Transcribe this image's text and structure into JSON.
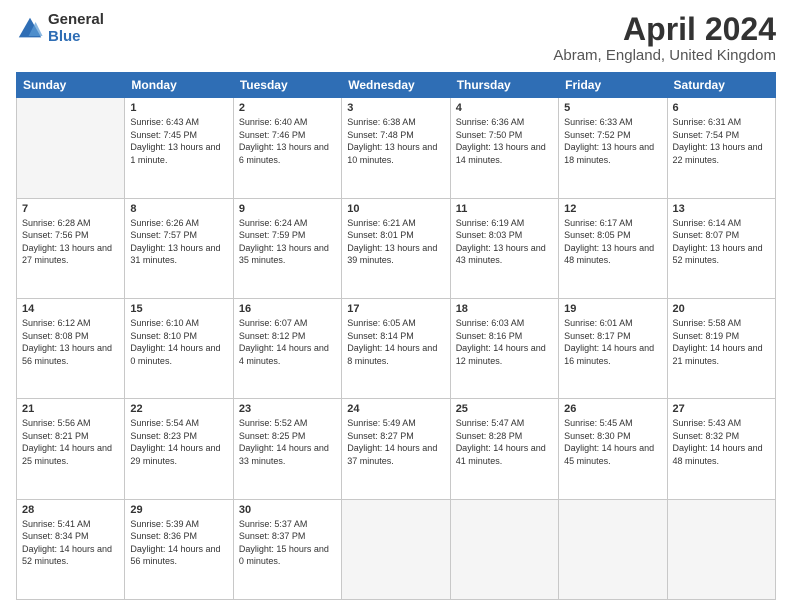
{
  "logo": {
    "general": "General",
    "blue": "Blue"
  },
  "title": "April 2024",
  "location": "Abram, England, United Kingdom",
  "weekdays": [
    "Sunday",
    "Monday",
    "Tuesday",
    "Wednesday",
    "Thursday",
    "Friday",
    "Saturday"
  ],
  "weeks": [
    [
      {
        "day": "",
        "sunrise": "",
        "sunset": "",
        "daylight": ""
      },
      {
        "day": "1",
        "sunrise": "6:43 AM",
        "sunset": "7:45 PM",
        "daylight": "13 hours and 1 minute."
      },
      {
        "day": "2",
        "sunrise": "6:40 AM",
        "sunset": "7:46 PM",
        "daylight": "13 hours and 6 minutes."
      },
      {
        "day": "3",
        "sunrise": "6:38 AM",
        "sunset": "7:48 PM",
        "daylight": "13 hours and 10 minutes."
      },
      {
        "day": "4",
        "sunrise": "6:36 AM",
        "sunset": "7:50 PM",
        "daylight": "13 hours and 14 minutes."
      },
      {
        "day": "5",
        "sunrise": "6:33 AM",
        "sunset": "7:52 PM",
        "daylight": "13 hours and 18 minutes."
      },
      {
        "day": "6",
        "sunrise": "6:31 AM",
        "sunset": "7:54 PM",
        "daylight": "13 hours and 22 minutes."
      }
    ],
    [
      {
        "day": "7",
        "sunrise": "6:28 AM",
        "sunset": "7:56 PM",
        "daylight": "13 hours and 27 minutes."
      },
      {
        "day": "8",
        "sunrise": "6:26 AM",
        "sunset": "7:57 PM",
        "daylight": "13 hours and 31 minutes."
      },
      {
        "day": "9",
        "sunrise": "6:24 AM",
        "sunset": "7:59 PM",
        "daylight": "13 hours and 35 minutes."
      },
      {
        "day": "10",
        "sunrise": "6:21 AM",
        "sunset": "8:01 PM",
        "daylight": "13 hours and 39 minutes."
      },
      {
        "day": "11",
        "sunrise": "6:19 AM",
        "sunset": "8:03 PM",
        "daylight": "13 hours and 43 minutes."
      },
      {
        "day": "12",
        "sunrise": "6:17 AM",
        "sunset": "8:05 PM",
        "daylight": "13 hours and 48 minutes."
      },
      {
        "day": "13",
        "sunrise": "6:14 AM",
        "sunset": "8:07 PM",
        "daylight": "13 hours and 52 minutes."
      }
    ],
    [
      {
        "day": "14",
        "sunrise": "6:12 AM",
        "sunset": "8:08 PM",
        "daylight": "13 hours and 56 minutes."
      },
      {
        "day": "15",
        "sunrise": "6:10 AM",
        "sunset": "8:10 PM",
        "daylight": "14 hours and 0 minutes."
      },
      {
        "day": "16",
        "sunrise": "6:07 AM",
        "sunset": "8:12 PM",
        "daylight": "14 hours and 4 minutes."
      },
      {
        "day": "17",
        "sunrise": "6:05 AM",
        "sunset": "8:14 PM",
        "daylight": "14 hours and 8 minutes."
      },
      {
        "day": "18",
        "sunrise": "6:03 AM",
        "sunset": "8:16 PM",
        "daylight": "14 hours and 12 minutes."
      },
      {
        "day": "19",
        "sunrise": "6:01 AM",
        "sunset": "8:17 PM",
        "daylight": "14 hours and 16 minutes."
      },
      {
        "day": "20",
        "sunrise": "5:58 AM",
        "sunset": "8:19 PM",
        "daylight": "14 hours and 21 minutes."
      }
    ],
    [
      {
        "day": "21",
        "sunrise": "5:56 AM",
        "sunset": "8:21 PM",
        "daylight": "14 hours and 25 minutes."
      },
      {
        "day": "22",
        "sunrise": "5:54 AM",
        "sunset": "8:23 PM",
        "daylight": "14 hours and 29 minutes."
      },
      {
        "day": "23",
        "sunrise": "5:52 AM",
        "sunset": "8:25 PM",
        "daylight": "14 hours and 33 minutes."
      },
      {
        "day": "24",
        "sunrise": "5:49 AM",
        "sunset": "8:27 PM",
        "daylight": "14 hours and 37 minutes."
      },
      {
        "day": "25",
        "sunrise": "5:47 AM",
        "sunset": "8:28 PM",
        "daylight": "14 hours and 41 minutes."
      },
      {
        "day": "26",
        "sunrise": "5:45 AM",
        "sunset": "8:30 PM",
        "daylight": "14 hours and 45 minutes."
      },
      {
        "day": "27",
        "sunrise": "5:43 AM",
        "sunset": "8:32 PM",
        "daylight": "14 hours and 48 minutes."
      }
    ],
    [
      {
        "day": "28",
        "sunrise": "5:41 AM",
        "sunset": "8:34 PM",
        "daylight": "14 hours and 52 minutes."
      },
      {
        "day": "29",
        "sunrise": "5:39 AM",
        "sunset": "8:36 PM",
        "daylight": "14 hours and 56 minutes."
      },
      {
        "day": "30",
        "sunrise": "5:37 AM",
        "sunset": "8:37 PM",
        "daylight": "15 hours and 0 minutes."
      },
      {
        "day": "",
        "sunrise": "",
        "sunset": "",
        "daylight": ""
      },
      {
        "day": "",
        "sunrise": "",
        "sunset": "",
        "daylight": ""
      },
      {
        "day": "",
        "sunrise": "",
        "sunset": "",
        "daylight": ""
      },
      {
        "day": "",
        "sunrise": "",
        "sunset": "",
        "daylight": ""
      }
    ]
  ]
}
